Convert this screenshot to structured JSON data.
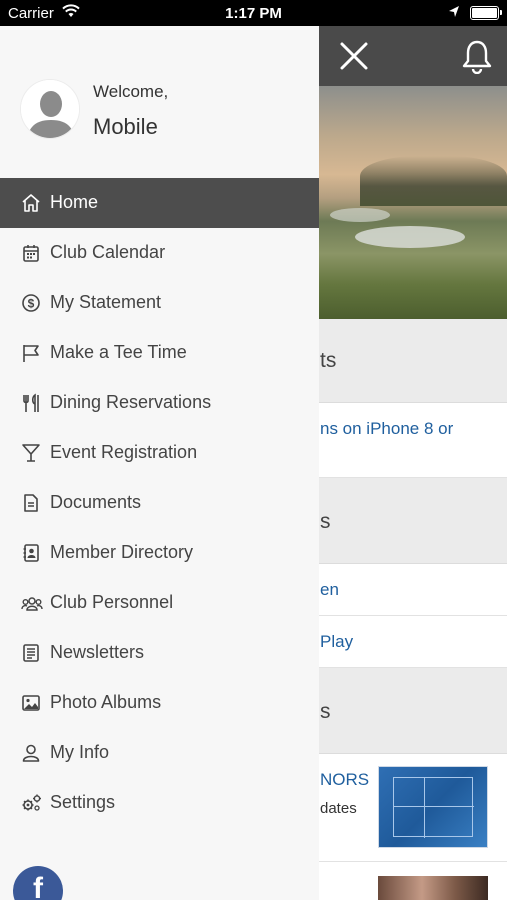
{
  "status_bar": {
    "carrier": "Carrier",
    "time": "1:17 PM"
  },
  "drawer": {
    "welcome": "Welcome,",
    "username": "Mobile",
    "menu": [
      {
        "label": "Home",
        "icon": "home-icon",
        "active": true
      },
      {
        "label": "Club Calendar",
        "icon": "calendar-icon"
      },
      {
        "label": "My Statement",
        "icon": "dollar-icon"
      },
      {
        "label": "Make a Tee Time",
        "icon": "flag-icon"
      },
      {
        "label": "Dining Reservations",
        "icon": "utensils-icon"
      },
      {
        "label": "Event Registration",
        "icon": "cocktail-icon"
      },
      {
        "label": "Documents",
        "icon": "document-icon"
      },
      {
        "label": "Member Directory",
        "icon": "contact-book-icon"
      },
      {
        "label": "Club Personnel",
        "icon": "group-icon"
      },
      {
        "label": "Newsletters",
        "icon": "newsletter-icon"
      },
      {
        "label": "Photo Albums",
        "icon": "photo-icon"
      },
      {
        "label": "My Info",
        "icon": "user-icon"
      },
      {
        "label": "Settings",
        "icon": "gears-icon"
      }
    ],
    "social": "f"
  },
  "background": {
    "section1": "ts",
    "section1_row1": "ns on iPhone 8 or",
    "section2": "s",
    "section2_row1": "en",
    "section2_row2": "Play",
    "section3": "s",
    "section3_row1_title": "NORS",
    "section3_row1_sub": "dates"
  },
  "colors": {
    "header": "#4a4a4a",
    "active_item": "#4d4d4d",
    "link": "#1f5f9e",
    "facebook": "#3b5998"
  }
}
